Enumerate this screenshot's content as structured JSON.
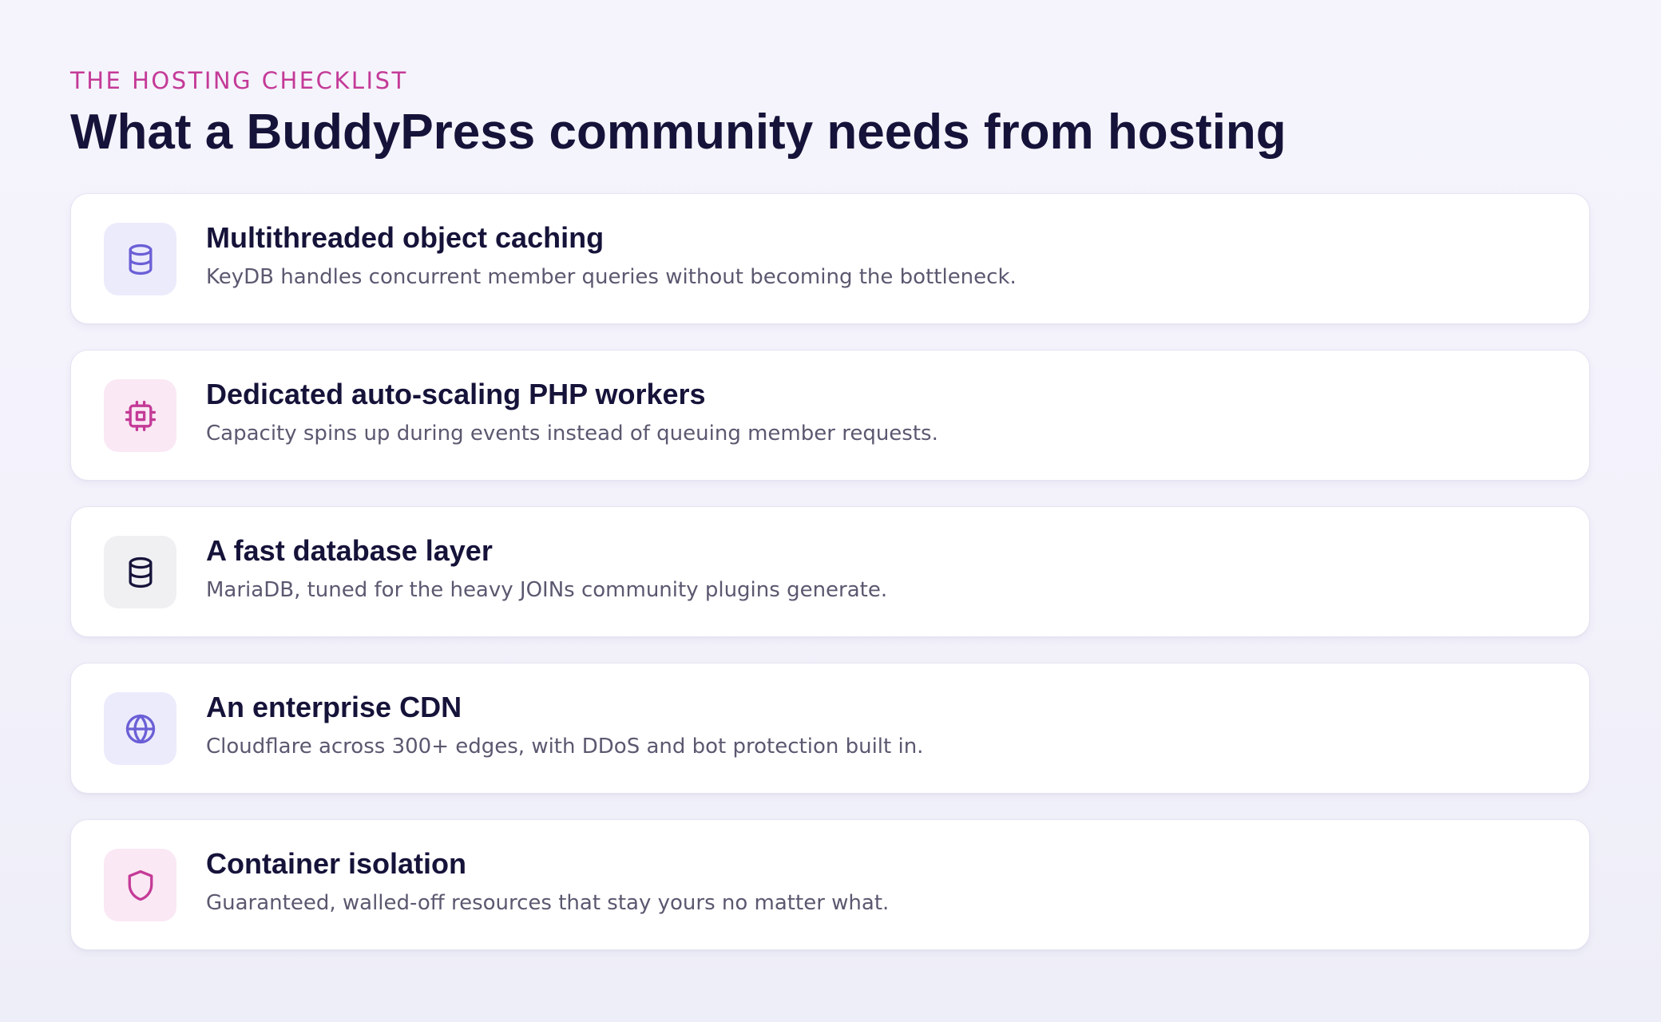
{
  "header": {
    "eyebrow": "THE HOSTING CHECKLIST",
    "title": "What a BuddyPress community needs from hosting"
  },
  "checklist": [
    {
      "title": "Multithreaded object caching",
      "description": "KeyDB handles concurrent member queries without becoming the bottleneck.",
      "icon": "database-icon",
      "icon_color": "#6b5fd6"
    },
    {
      "title": "Dedicated auto-scaling PHP workers",
      "description": "Capacity spins up during events instead of queuing member requests.",
      "icon": "cpu-icon",
      "icon_color": "#c43a97"
    },
    {
      "title": "A fast database layer",
      "description": "MariaDB, tuned for the heavy JOINs community plugins generate.",
      "icon": "database-icon",
      "icon_color": "#16133a"
    },
    {
      "title": "An enterprise CDN",
      "description": "Cloudflare across 300+ edges, with DDoS and bot protection built in.",
      "icon": "globe-icon",
      "icon_color": "#6b5fd6"
    },
    {
      "title": "Container isolation",
      "description": "Guaranteed, walled-off resources that stay yours no matter what.",
      "icon": "shield-icon",
      "icon_color": "#c43a97"
    }
  ],
  "colors": {
    "accent_pink": "#c43a97",
    "accent_violet": "#6b5fd6",
    "heading": "#16133a",
    "body_text": "#5b5870"
  }
}
